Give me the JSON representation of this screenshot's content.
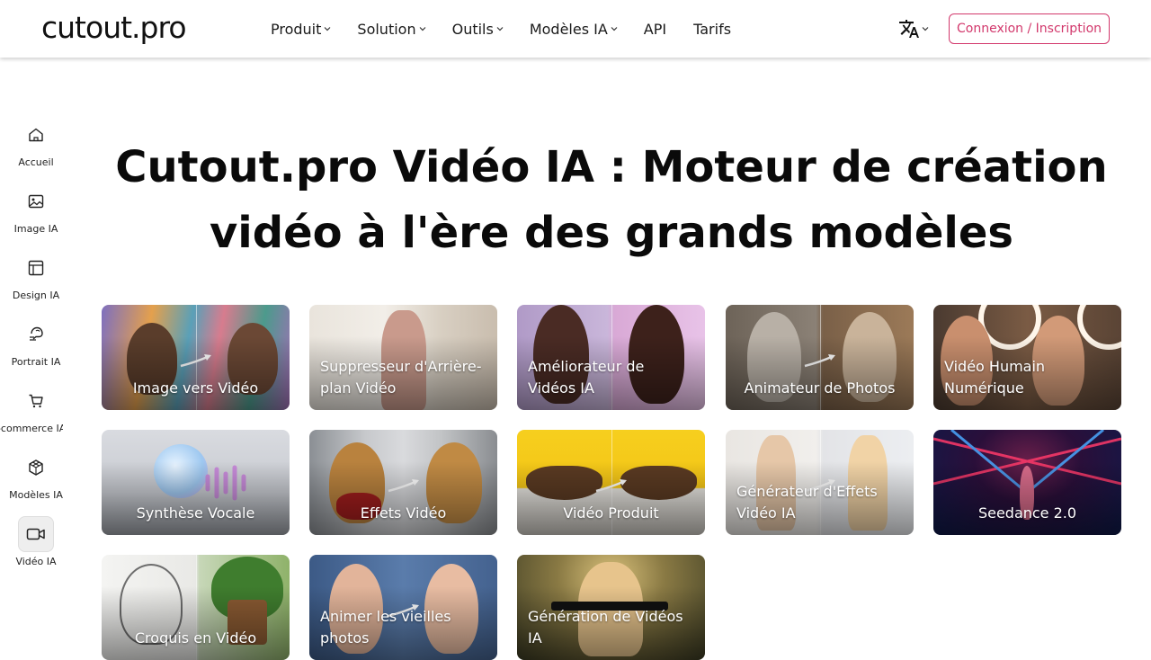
{
  "header": {
    "logo": "cutout.pro",
    "nav": [
      {
        "label": "Produit",
        "dropdown": true
      },
      {
        "label": "Solution",
        "dropdown": true
      },
      {
        "label": "Outils",
        "dropdown": true
      },
      {
        "label": "Modèles IA",
        "dropdown": true
      },
      {
        "label": "API",
        "dropdown": false
      },
      {
        "label": "Tarifs",
        "dropdown": false
      }
    ],
    "language_icon": "translate-icon",
    "login_label": "Connexion / Inscription"
  },
  "sidebar": {
    "items": [
      {
        "label": "Accueil",
        "icon": "home-icon"
      },
      {
        "label": "Image IA",
        "icon": "image-icon"
      },
      {
        "label": "Design IA",
        "icon": "layout-icon"
      },
      {
        "label": "Portrait IA",
        "icon": "portrait-icon"
      },
      {
        "label": "E-commerce IA",
        "icon": "cart-icon"
      },
      {
        "label": "Modèles IA",
        "icon": "cube-icon"
      },
      {
        "label": "Vidéo IA",
        "icon": "video-icon",
        "active": true
      }
    ]
  },
  "main": {
    "title_line1": "Cutout.pro Vidéo IA : Moteur de création",
    "title_line2": "vidéo à l'ère des grands modèles",
    "cards": [
      {
        "label": "Image vers Vidéo"
      },
      {
        "label": "Suppresseur d'Arrière-plan Vidéo"
      },
      {
        "label": "Améliorateur de Vidéos IA"
      },
      {
        "label": "Animateur de Photos"
      },
      {
        "label": "Vidéo Humain Numérique"
      },
      {
        "label": "Synthèse Vocale"
      },
      {
        "label": "Effets Vidéo"
      },
      {
        "label": "Vidéo Produit"
      },
      {
        "label": "Générateur d'Effets Vidéo IA"
      },
      {
        "label": "Seedance 2.0"
      },
      {
        "label": "Croquis en Vidéo"
      },
      {
        "label": "Animer les vieilles photos"
      },
      {
        "label": "Génération de Vidéos IA"
      }
    ]
  },
  "colors": {
    "accent": "#d2386c",
    "active_bg": "#eeeeee"
  }
}
